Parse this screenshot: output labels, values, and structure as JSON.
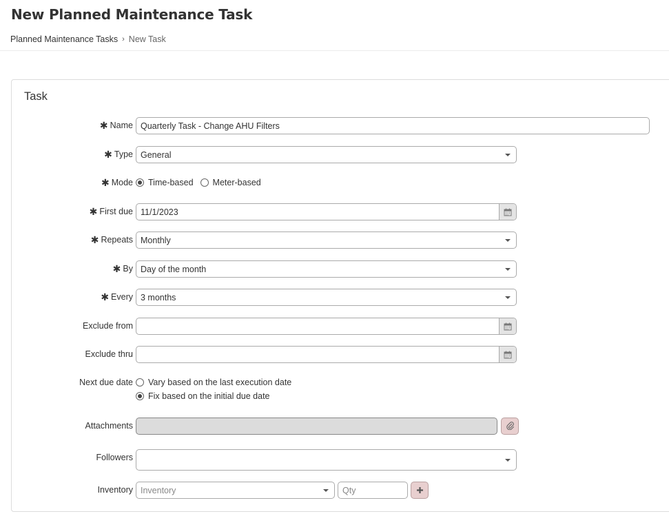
{
  "page": {
    "title": "New Planned Maintenance Task",
    "breadcrumb": {
      "parent": "Planned Maintenance Tasks",
      "separator": "›",
      "current": "New Task"
    }
  },
  "panel": {
    "title": "Task"
  },
  "form": {
    "name": {
      "label": "Name",
      "required": true,
      "value": "Quarterly Task - Change AHU Filters"
    },
    "type": {
      "label": "Type",
      "required": true,
      "value": "General"
    },
    "mode": {
      "label": "Mode",
      "required": true,
      "options": [
        "Time-based",
        "Meter-based"
      ],
      "selected": "Time-based"
    },
    "first_due": {
      "label": "First due",
      "required": true,
      "value": "11/1/2023"
    },
    "repeats": {
      "label": "Repeats",
      "required": true,
      "value": "Monthly"
    },
    "by": {
      "label": "By",
      "required": true,
      "value": "Day of the month"
    },
    "every": {
      "label": "Every",
      "required": true,
      "value": "3 months"
    },
    "exclude_from": {
      "label": "Exclude from",
      "value": ""
    },
    "exclude_thru": {
      "label": "Exclude thru",
      "value": ""
    },
    "next_due_date": {
      "label": "Next due date",
      "options": [
        "Vary based on the last execution date",
        "Fix based on the initial due date"
      ],
      "selected": "Fix based on the initial due date"
    },
    "attachments": {
      "label": "Attachments",
      "icon": "paperclip-icon"
    },
    "followers": {
      "label": "Followers",
      "value": ""
    },
    "inventory": {
      "label": "Inventory",
      "item_placeholder": "Inventory",
      "qty_placeholder": "Qty",
      "add_icon": "plus-icon"
    }
  },
  "required_marker": "✱",
  "colors": {
    "border": "#aaaaaa",
    "attach_button_bg": "#e8cfcf",
    "disabled_bg": "#dcdcdc"
  }
}
